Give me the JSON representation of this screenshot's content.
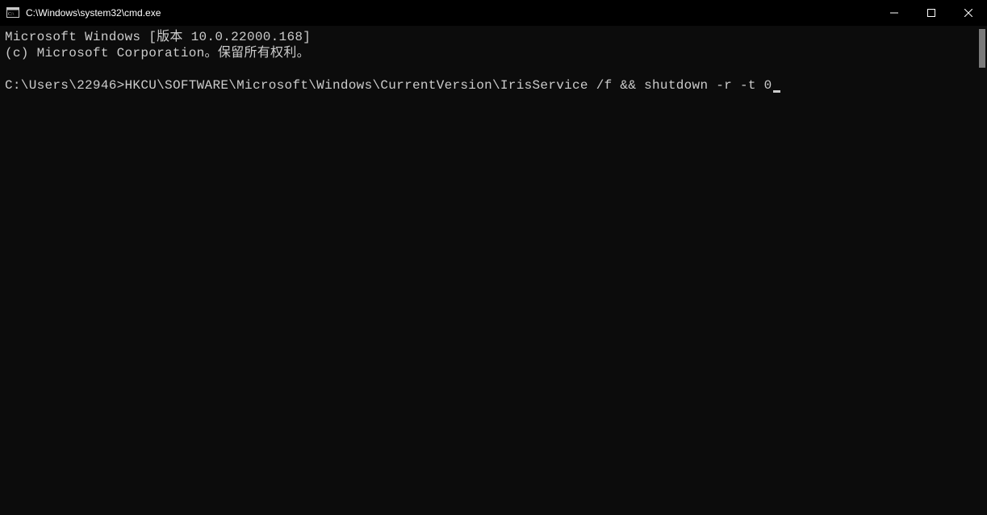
{
  "titlebar": {
    "path": "C:\\Windows\\system32\\cmd.exe"
  },
  "terminal": {
    "line1": "Microsoft Windows [版本 10.0.22000.168]",
    "line2": "(c) Microsoft Corporation。保留所有权利。",
    "blank": "",
    "prompt": "C:\\Users\\22946>",
    "command": "HKCU\\SOFTWARE\\Microsoft\\Windows\\CurrentVersion\\IrisService /f && shutdown -r -t 0"
  }
}
